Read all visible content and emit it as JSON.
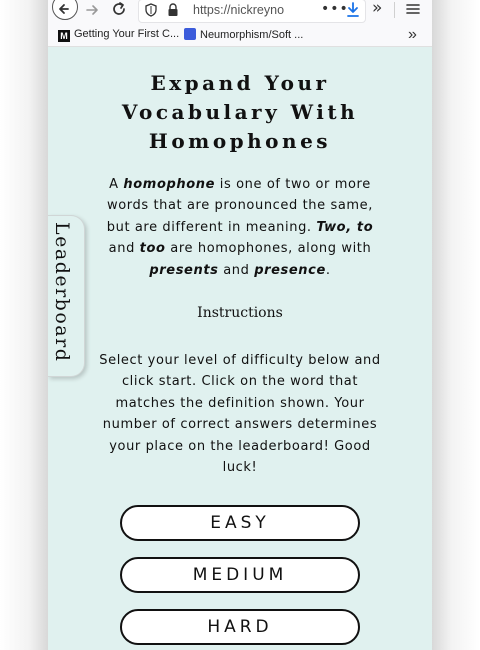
{
  "browser": {
    "url": "https://nickreyno",
    "bookmarks": [
      {
        "label": "Getting Your First C...",
        "icon": "medium-logo-icon"
      },
      {
        "label": "Neumorphism/Soft ...",
        "icon": "blue-page-icon"
      }
    ],
    "overflow_glyph": "»"
  },
  "page": {
    "title_lines": [
      "Expand Your",
      "Vocabulary With",
      "Homophones"
    ],
    "intro": {
      "part1": "A ",
      "term": "homophone",
      "part2": " is one of two or more words that are pronounced the same, but are different in meaning. ",
      "ex1": "Two, to",
      "part3": " and ",
      "ex2": "too",
      "part4": " are homophones, along with ",
      "ex3": "presents",
      "part5": " and ",
      "ex4": "presence",
      "part6": "."
    },
    "instructions_heading": "Instructions",
    "instructions_text": "Select your level of difficulty below and click start. Click on the word that matches the definition shown. Your number of correct answers determines your place on the leaderboard! Good luck!",
    "leaderboard_label": "Leaderboard",
    "levels": [
      "EASY",
      "MEDIUM",
      "HARD"
    ]
  },
  "colors": {
    "page_background": "#e0f1ef",
    "button_border": "#111111"
  }
}
